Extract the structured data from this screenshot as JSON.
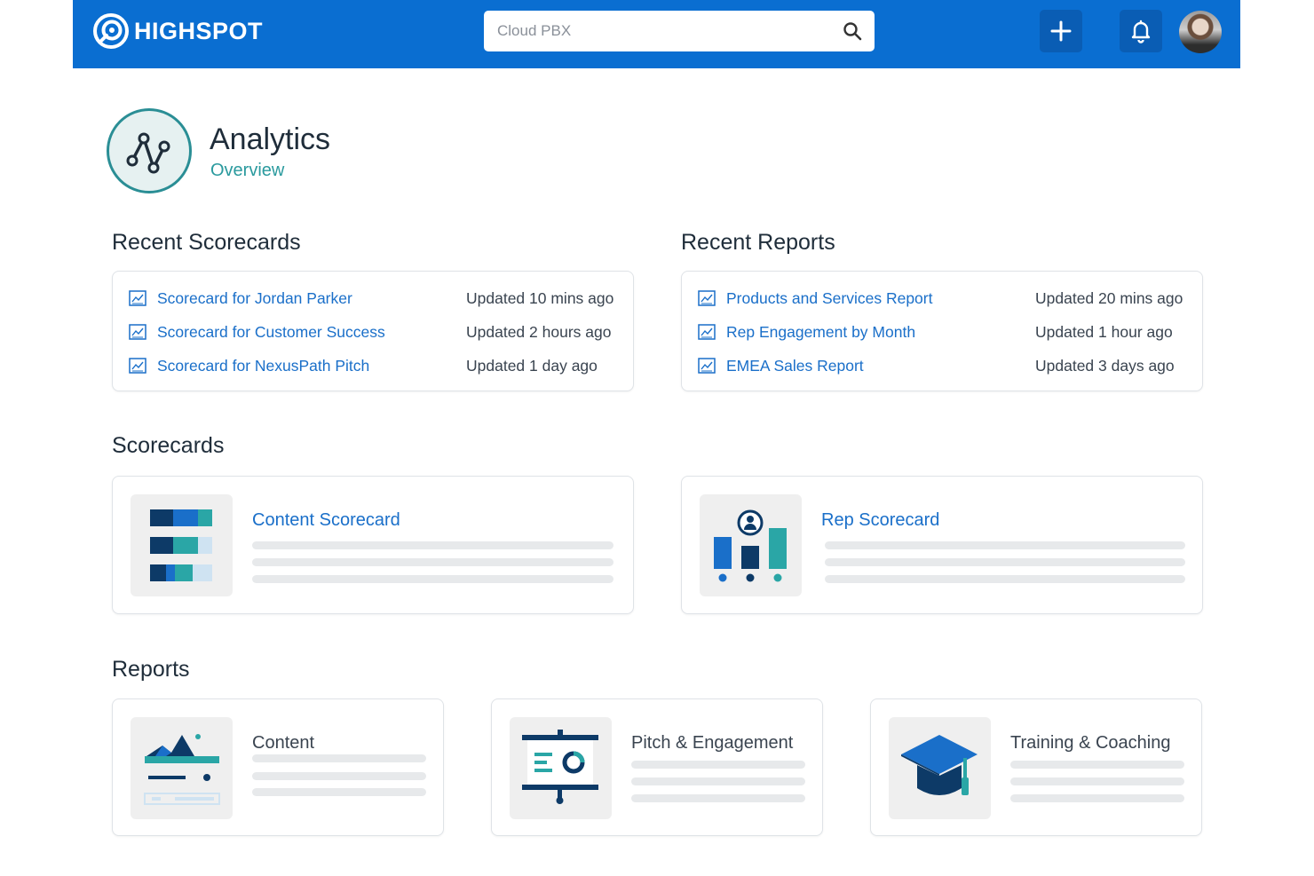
{
  "brand": {
    "name": "HIGHSPOT"
  },
  "search": {
    "value": "Cloud PBX",
    "placeholder": "Search"
  },
  "page": {
    "title": "Analytics",
    "subtitle": "Overview"
  },
  "recent_scorecards": {
    "heading": "Recent Scorecards",
    "items": [
      {
        "label": "Scorecard for Jordan Parker",
        "updated": "Updated 10 mins ago"
      },
      {
        "label": "Scorecard for Customer Success",
        "updated": "Updated 2 hours ago"
      },
      {
        "label": "Scorecard for NexusPath Pitch",
        "updated": "Updated 1 day ago"
      }
    ]
  },
  "recent_reports": {
    "heading": "Recent Reports",
    "items": [
      {
        "label": "Products and Services Report",
        "updated": "Updated 20 mins ago"
      },
      {
        "label": "Rep Engagement by Month",
        "updated": "Updated 1 hour ago"
      },
      {
        "label": "EMEA Sales Report",
        "updated": "Updated 3 days ago"
      }
    ]
  },
  "scorecards": {
    "heading": "Scorecards",
    "items": [
      {
        "title": "Content Scorecard"
      },
      {
        "title": "Rep Scorecard"
      }
    ]
  },
  "reports": {
    "heading": "Reports",
    "items": [
      {
        "title": "Content"
      },
      {
        "title": "Pitch & Engagement"
      },
      {
        "title": "Training & Coaching"
      }
    ]
  },
  "colors": {
    "topbar": "#0a6ed1",
    "link": "#1a6fc9",
    "accent_teal": "#2a9a9e",
    "navy": "#0d3a67"
  },
  "icons": {
    "logo": "highspot-logo-icon",
    "search": "search-icon",
    "add": "plus-icon",
    "notifications": "bell-icon",
    "analytics": "analytics-chart-icon",
    "list_item": "report-chart-icon"
  }
}
